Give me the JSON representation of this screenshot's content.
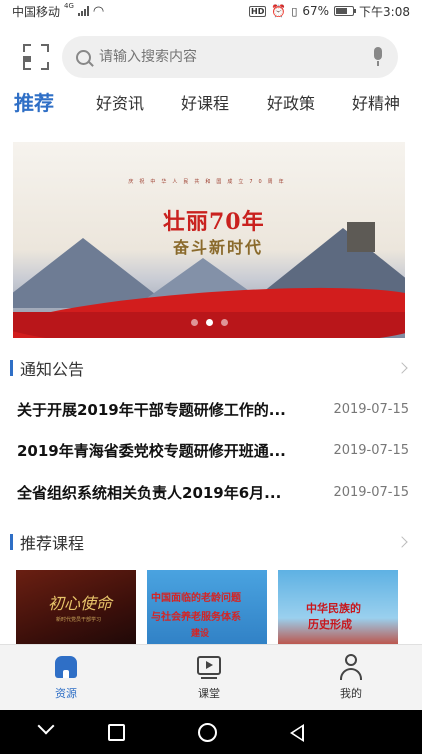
{
  "status_bar": {
    "carrier": "中国移动",
    "network": "4G",
    "hd_badge": "HD",
    "battery": "67%",
    "battery_level": 0.67,
    "time": "下午3:08"
  },
  "search": {
    "placeholder": "请输入搜索内容"
  },
  "tabs": [
    {
      "label": "推荐",
      "active": true
    },
    {
      "label": "好资讯",
      "active": false
    },
    {
      "label": "好课程",
      "active": false
    },
    {
      "label": "好政策",
      "active": false
    },
    {
      "label": "好精神",
      "active": false
    }
  ],
  "banner": {
    "subtitle": "庆祝中华人民共和国成立70周年",
    "title_line1": "壮丽70年",
    "title_line2": "奋斗新时代",
    "page_count": 3,
    "active_page": 1
  },
  "notices": {
    "heading": "通知公告",
    "items": [
      {
        "title": "关于开展2019年干部专题研修工作的...",
        "date": "2019-07-15"
      },
      {
        "title": "2019年青海省委党校专题研修开班通...",
        "date": "2019-07-15"
      },
      {
        "title": "全省组织系统相关负责人2019年6月...",
        "date": "2019-07-15"
      }
    ]
  },
  "courses": {
    "heading": "推荐课程",
    "items": [
      {
        "thumb_title": "初心使命",
        "thumb_sub": "新时代党员干部学习"
      },
      {
        "thumb_title_1": "中国面临的老龄问题",
        "thumb_title_2": "与社会养老服务体系",
        "thumb_title_3": "建设"
      },
      {
        "thumb_title_1": "中华民族的",
        "thumb_title_2": "历史形成"
      }
    ]
  },
  "bottom_nav": [
    {
      "label": "资源",
      "icon": "home-icon",
      "active": true
    },
    {
      "label": "课堂",
      "icon": "video-classroom-icon",
      "active": false
    },
    {
      "label": "我的",
      "icon": "profile-icon",
      "active": false
    }
  ],
  "colors": {
    "accent": "#2f6fc6",
    "banner_red": "#d21d1d"
  }
}
